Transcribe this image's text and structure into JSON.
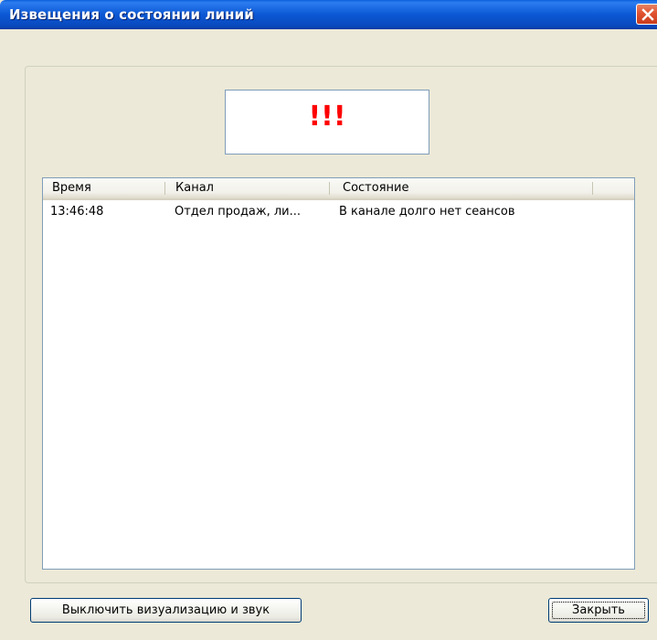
{
  "window": {
    "title": "Извещения о состоянии линий"
  },
  "indicator": {
    "text": "!!!",
    "color": "#ff0000"
  },
  "list": {
    "columns": [
      "Время",
      "Канал",
      "Состояние"
    ],
    "rows": [
      [
        "13:46:48",
        "Отдел продаж, ли...",
        "В канале долго нет сеансов"
      ]
    ]
  },
  "buttons": {
    "mute_label": "Выключить визуализацию и звук",
    "close_label": "Закрыть"
  },
  "colors": {
    "titlebar": "#0b58d4",
    "window_bg": "#ece9d8",
    "close_button": "#e05230",
    "border": "#7f9db9"
  },
  "icons": {
    "close": "close-icon"
  }
}
